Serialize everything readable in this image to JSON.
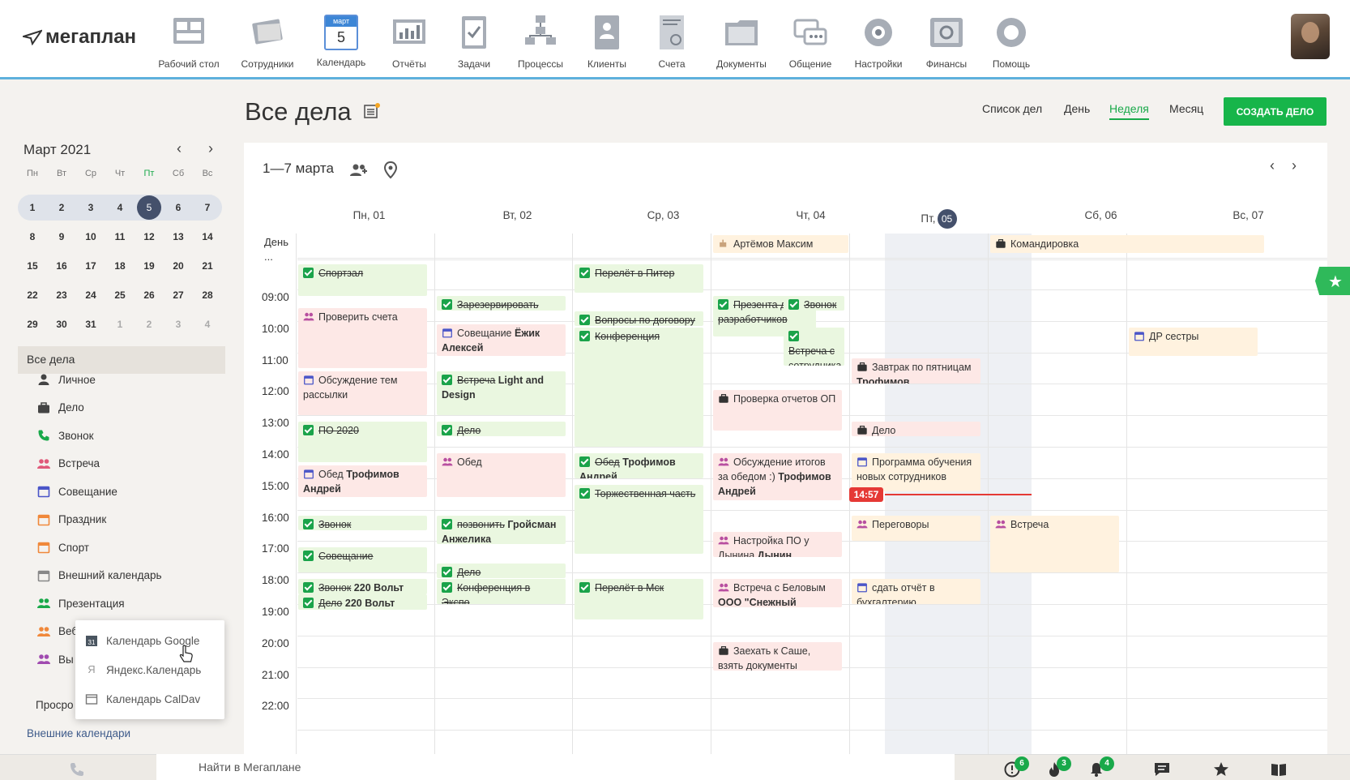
{
  "app": {
    "logo_text": "мегаплан"
  },
  "nav": [
    {
      "label": "Рабочий стол",
      "icon": "desktop-icon"
    },
    {
      "label": "Сотрудники",
      "icon": "employees-icon"
    },
    {
      "label": "Календарь",
      "icon": "calendar-icon",
      "icon_month": "март",
      "icon_day": "5"
    },
    {
      "label": "Отчёты",
      "icon": "reports-icon"
    },
    {
      "label": "Задачи",
      "icon": "tasks-icon"
    },
    {
      "label": "Процессы",
      "icon": "processes-icon"
    },
    {
      "label": "Клиенты",
      "icon": "clients-icon"
    },
    {
      "label": "Счета",
      "icon": "invoices-icon"
    },
    {
      "label": "Документы",
      "icon": "documents-icon"
    },
    {
      "label": "Общение",
      "icon": "chat-icon"
    },
    {
      "label": "Настройки",
      "icon": "settings-icon"
    },
    {
      "label": "Финансы",
      "icon": "finance-icon"
    },
    {
      "label": "Помощь",
      "icon": "help-icon"
    }
  ],
  "header": {
    "title": "Все дела",
    "views": [
      "Список дел",
      "День",
      "Неделя",
      "Месяц"
    ],
    "active_view": "Неделя",
    "create_button": "СОЗДАТЬ ДЕЛО"
  },
  "mini_calendar": {
    "title": "Март 2021",
    "weekdays": [
      "Пн",
      "Вт",
      "Ср",
      "Чт",
      "Пт",
      "Сб",
      "Вс"
    ],
    "weeks": [
      [
        "1",
        "2",
        "3",
        "4",
        "5",
        "6",
        "7"
      ],
      [
        "8",
        "9",
        "10",
        "11",
        "12",
        "13",
        "14"
      ],
      [
        "15",
        "16",
        "17",
        "18",
        "19",
        "20",
        "21"
      ],
      [
        "22",
        "23",
        "24",
        "25",
        "26",
        "27",
        "28"
      ],
      [
        "29",
        "30",
        "31",
        "1",
        "2",
        "3",
        "4"
      ]
    ],
    "today": "5"
  },
  "sidebar": {
    "all_label": "Все дела",
    "categories": [
      {
        "label": "Личное",
        "icon": "person-icon",
        "color": "#444444"
      },
      {
        "label": "Дело",
        "icon": "briefcase-icon",
        "color": "#444444"
      },
      {
        "label": "Звонок",
        "icon": "phone-icon",
        "color": "#19a94a"
      },
      {
        "label": "Встреча",
        "icon": "people-icon",
        "color": "#e05a7a"
      },
      {
        "label": "Совещание",
        "icon": "calendar-icon",
        "color": "#4a55c8"
      },
      {
        "label": "Праздник",
        "icon": "calendar-icon",
        "color": "#f0883a"
      },
      {
        "label": "Спорт",
        "icon": "calendar-icon",
        "color": "#f0883a"
      },
      {
        "label": "Внешний календарь",
        "icon": "calendar-icon",
        "color": "#888888"
      },
      {
        "label": "Презентация",
        "icon": "people-icon",
        "color": "#19a94a"
      },
      {
        "label": "Веб",
        "icon": "people-icon",
        "color": "#f0883a"
      },
      {
        "label": "Вы",
        "icon": "people-icon",
        "color": "#a04bb0"
      }
    ],
    "overdue_label": "Просро",
    "external_calendars_label": "Внешние календари"
  },
  "popup": {
    "items": [
      {
        "label": "Календарь Google",
        "icon": "google-calendar-icon"
      },
      {
        "label": "Яндекс.Календарь",
        "icon": "yandex-icon"
      },
      {
        "label": "Календарь CalDav",
        "icon": "calendar-icon"
      }
    ]
  },
  "calendar": {
    "range": "1—7 марта",
    "days": [
      "Пн, 01",
      "Вт, 02",
      "Ср, 03",
      "Чт, 04",
      "Пт,",
      "Сб, 06",
      "Вс, 07"
    ],
    "today_badge": "05",
    "allday_label": "День\n...",
    "hours": [
      "09:00",
      "10:00",
      "11:00",
      "12:00",
      "13:00",
      "14:00",
      "15:00",
      "16:00",
      "17:00",
      "18:00",
      "19:00",
      "20:00",
      "21:00",
      "22:00"
    ],
    "now": "14:57",
    "allday_events": [
      {
        "day": 3,
        "span": 1,
        "title": "Артёмов Максим",
        "icon": "birthday-icon",
        "color": "y"
      },
      {
        "day": 5,
        "span": 2,
        "title": "Командировка",
        "icon": "briefcase-icon",
        "color": "y"
      }
    ],
    "events": [
      {
        "day": 0,
        "start": 8.2,
        "end": 9.2,
        "color": "g",
        "icon": "check",
        "strike": "Спортзал",
        "text": ""
      },
      {
        "day": 0,
        "start": 9.6,
        "end": 11.5,
        "color": "r",
        "icon": "people-icon",
        "strike": "",
        "text": "Проверить счета"
      },
      {
        "day": 0,
        "start": 11.6,
        "end": 13.0,
        "color": "r",
        "icon": "calendar-icon",
        "strike": "",
        "text": "Обсуждение тем рассылки"
      },
      {
        "day": 0,
        "start": 13.2,
        "end": 14.5,
        "color": "g",
        "icon": "check",
        "strike": "ПО 2020",
        "text": ""
      },
      {
        "day": 0,
        "start": 14.6,
        "end": 15.6,
        "color": "r",
        "icon": "calendar-icon",
        "strike": "",
        "text": "Обед ",
        "bold": "Трофимов Андрей"
      },
      {
        "day": 0,
        "start": 16.2,
        "end": 16.6,
        "color": "g",
        "icon": "check",
        "strike": "Звонок",
        "text": ""
      },
      {
        "day": 0,
        "start": 17.2,
        "end": 18.0,
        "color": "g",
        "icon": "check",
        "strike": "Совещание",
        "text": ""
      },
      {
        "day": 0,
        "start": 18.2,
        "end": 18.7,
        "color": "g",
        "icon": "check",
        "strike": "Звонок",
        "text": "",
        "bold": " 220 Вольт"
      },
      {
        "day": 0,
        "start": 18.7,
        "end": 19.2,
        "color": "g",
        "icon": "check",
        "strike": "Дело",
        "text": "",
        "bold": " 220 Вольт"
      },
      {
        "day": 1,
        "start": 9.2,
        "end": 9.6,
        "color": "g",
        "icon": "check",
        "strike": "Зарезервировать",
        "text": ""
      },
      {
        "day": 1,
        "start": 10.1,
        "end": 11.1,
        "color": "r",
        "icon": "calendar-icon",
        "strike": "",
        "text": "Совещание ",
        "bold": "Ёжик Алексей"
      },
      {
        "day": 1,
        "start": 11.6,
        "end": 13.0,
        "color": "g",
        "icon": "check",
        "strike": "Встреча",
        "text": "",
        "bold": " Light and Design"
      },
      {
        "day": 1,
        "start": 13.2,
        "end": 13.6,
        "color": "g",
        "icon": "check",
        "strike": "Дело",
        "text": ""
      },
      {
        "day": 1,
        "start": 14.2,
        "end": 15.6,
        "color": "r",
        "icon": "people-icon",
        "strike": "",
        "text": "Обед"
      },
      {
        "day": 1,
        "start": 16.2,
        "end": 17.1,
        "color": "g",
        "icon": "check",
        "strike": "позвонить",
        "text": "",
        "bold": " Гройсман Анжелика"
      },
      {
        "day": 1,
        "start": 17.7,
        "end": 18.1,
        "color": "g",
        "icon": "check",
        "strike": "Дело",
        "text": ""
      },
      {
        "day": 1,
        "start": 18.2,
        "end": 19.0,
        "color": "g",
        "icon": "check",
        "strike": "Конференция в Экспо",
        "text": ""
      },
      {
        "day": 2,
        "start": 8.2,
        "end": 9.1,
        "color": "g",
        "icon": "check",
        "strike": "Перелёт в Питер",
        "text": ""
      },
      {
        "day": 2,
        "start": 9.7,
        "end": 10.1,
        "color": "g",
        "icon": "check",
        "strike": "Вопросы по договору",
        "text": ""
      },
      {
        "day": 2,
        "start": 10.2,
        "end": 14.0,
        "color": "g",
        "icon": "check",
        "strike": "Конференция",
        "text": ""
      },
      {
        "day": 2,
        "start": 14.2,
        "end": 15.0,
        "color": "g",
        "icon": "check",
        "strike": "Обед",
        "text": "",
        "bold": " Трофимов Андрей"
      },
      {
        "day": 2,
        "start": 15.2,
        "end": 17.4,
        "color": "g",
        "icon": "check",
        "strike": "Торжественная часть",
        "text": ""
      },
      {
        "day": 2,
        "start": 18.2,
        "end": 19.5,
        "color": "g",
        "icon": "check",
        "strike": "Перелёт в Мск",
        "text": ""
      },
      {
        "day": 3,
        "start": 9.2,
        "end": 10.5,
        "color": "g",
        "icon": "check",
        "strike": "Презента для разработчиков",
        "text": "",
        "half": "left"
      },
      {
        "day": 3,
        "start": 9.2,
        "end": 9.6,
        "color": "g",
        "icon": "check",
        "strike": "Звонок",
        "text": "",
        "half": "right"
      },
      {
        "day": 3,
        "start": 10.2,
        "end": 11.4,
        "color": "g",
        "icon": "check",
        "strike": "Встреча с сотрудника",
        "text": "",
        "half": "right"
      },
      {
        "day": 3,
        "start": 12.2,
        "end": 13.5,
        "color": "r",
        "icon": "briefcase-icon",
        "strike": "",
        "text": "Проверка отчетов ОП"
      },
      {
        "day": 3,
        "start": 14.2,
        "end": 15.7,
        "color": "r",
        "icon": "people-icon",
        "strike": "",
        "text": "Обсуждение итогов за обедом :) ",
        "bold": "Трофимов Андрей"
      },
      {
        "day": 3,
        "start": 16.7,
        "end": 17.5,
        "color": "r",
        "icon": "people-icon",
        "strike": "",
        "text": "Настройка ПО у Дынина ",
        "bold": "Дынин Товарищ"
      },
      {
        "day": 3,
        "start": 18.2,
        "end": 19.1,
        "color": "r",
        "icon": "people-icon",
        "strike": "",
        "text": "Встреча с Беловым ",
        "bold": "ООО \"Снежный"
      },
      {
        "day": 3,
        "start": 20.2,
        "end": 21.1,
        "color": "r",
        "icon": "briefcase-icon",
        "strike": "",
        "text": "Заехать к Саше, взять документы"
      },
      {
        "day": 4,
        "start": 11.2,
        "end": 12.0,
        "color": "r",
        "icon": "briefcase-icon",
        "strike": "",
        "text": "Завтрак по пятницам ",
        "bold": "Трофимов"
      },
      {
        "day": 4,
        "start": 13.2,
        "end": 13.6,
        "color": "r",
        "icon": "briefcase-icon",
        "strike": "",
        "text": "Дело"
      },
      {
        "day": 4,
        "start": 14.2,
        "end": 15.4,
        "color": "y",
        "icon": "calendar-icon",
        "strike": "",
        "text": "Программа обучения новых сотрудников"
      },
      {
        "day": 4,
        "start": 16.2,
        "end": 17.0,
        "color": "y",
        "icon": "people-icon",
        "strike": "",
        "text": "Переговоры"
      },
      {
        "day": 4,
        "start": 18.2,
        "end": 19.0,
        "color": "y",
        "icon": "calendar-icon",
        "strike": "",
        "text": "сдать отчёт в бухгалтерию"
      },
      {
        "day": 5,
        "start": 16.2,
        "end": 18.0,
        "color": "y",
        "icon": "people-icon",
        "strike": "",
        "text": "Встреча"
      },
      {
        "day": 6,
        "start": 10.2,
        "end": 11.1,
        "color": "y",
        "icon": "calendar-icon",
        "strike": "",
        "text": "ДР сестры"
      }
    ]
  },
  "bottombar": {
    "search_placeholder": "Найти в Мегаплане",
    "badges": {
      "alerts": "6",
      "hot": "3",
      "notifications": "4"
    }
  },
  "colors": {
    "accent": "#19a94a",
    "nav_border": "#5eb0dc",
    "now_line": "#e53935"
  }
}
